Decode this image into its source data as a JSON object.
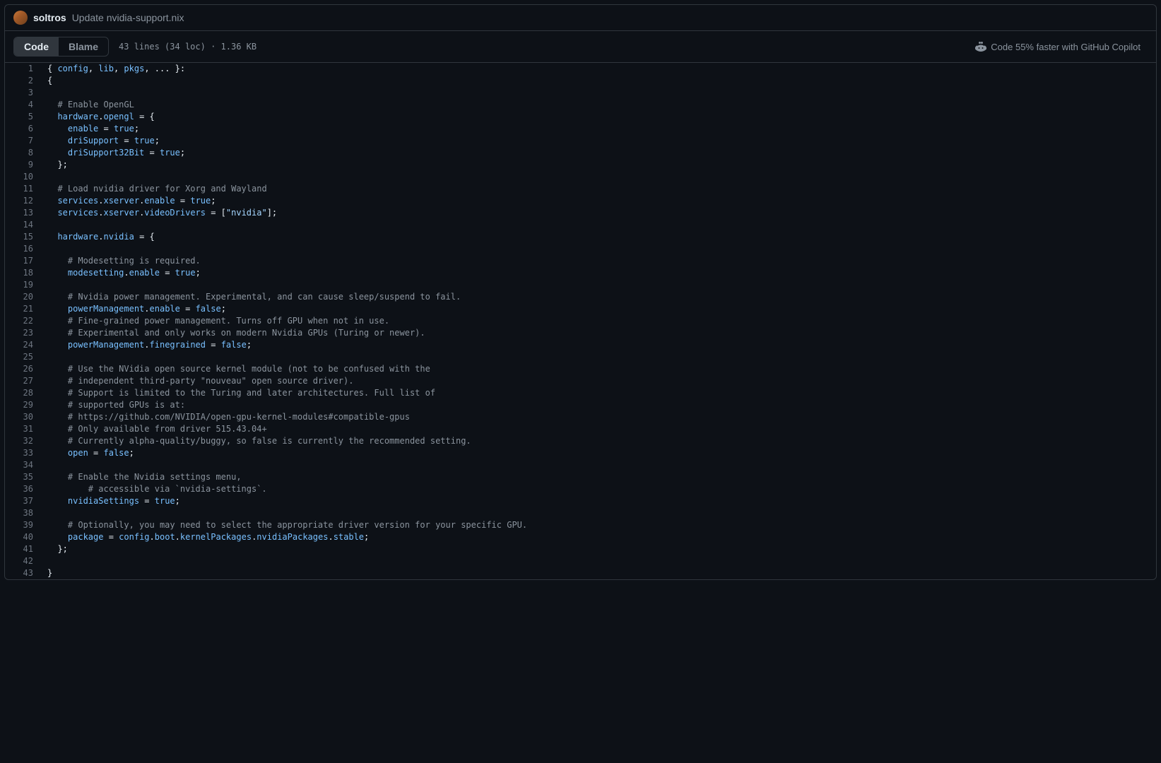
{
  "commit": {
    "author": "soltros",
    "message": "Update nvidia-support.nix"
  },
  "toolbar": {
    "code_tab": "Code",
    "blame_tab": "Blame",
    "file_info": "43 lines (34 loc) · 1.36 KB",
    "copilot_text": "Code 55% faster with GitHub Copilot"
  },
  "code_lines": [
    {
      "n": 1,
      "tokens": [
        [
          "punc",
          "{ "
        ],
        [
          "attr",
          "config"
        ],
        [
          "punc",
          ", "
        ],
        [
          "attr",
          "lib"
        ],
        [
          "punc",
          ", "
        ],
        [
          "attr",
          "pkgs"
        ],
        [
          "punc",
          ", ... }:"
        ]
      ]
    },
    {
      "n": 2,
      "tokens": [
        [
          "punc",
          "{"
        ]
      ]
    },
    {
      "n": 3,
      "tokens": []
    },
    {
      "n": 4,
      "tokens": [
        [
          "punc",
          "  "
        ],
        [
          "comment",
          "# Enable OpenGL"
        ]
      ]
    },
    {
      "n": 5,
      "tokens": [
        [
          "punc",
          "  "
        ],
        [
          "attr",
          "hardware"
        ],
        [
          "punc",
          "."
        ],
        [
          "attr",
          "opengl"
        ],
        [
          "punc",
          " = {"
        ]
      ]
    },
    {
      "n": 6,
      "tokens": [
        [
          "punc",
          "    "
        ],
        [
          "attr",
          "enable"
        ],
        [
          "punc",
          " = "
        ],
        [
          "bool",
          "true"
        ],
        [
          "punc",
          ";"
        ]
      ]
    },
    {
      "n": 7,
      "tokens": [
        [
          "punc",
          "    "
        ],
        [
          "attr",
          "driSupport"
        ],
        [
          "punc",
          " = "
        ],
        [
          "bool",
          "true"
        ],
        [
          "punc",
          ";"
        ]
      ]
    },
    {
      "n": 8,
      "tokens": [
        [
          "punc",
          "    "
        ],
        [
          "attr",
          "driSupport32Bit"
        ],
        [
          "punc",
          " = "
        ],
        [
          "bool",
          "true"
        ],
        [
          "punc",
          ";"
        ]
      ]
    },
    {
      "n": 9,
      "tokens": [
        [
          "punc",
          "  };"
        ]
      ]
    },
    {
      "n": 10,
      "tokens": []
    },
    {
      "n": 11,
      "tokens": [
        [
          "punc",
          "  "
        ],
        [
          "comment",
          "# Load nvidia driver for Xorg and Wayland"
        ]
      ]
    },
    {
      "n": 12,
      "tokens": [
        [
          "punc",
          "  "
        ],
        [
          "attr",
          "services"
        ],
        [
          "punc",
          "."
        ],
        [
          "attr",
          "xserver"
        ],
        [
          "punc",
          "."
        ],
        [
          "attr",
          "enable"
        ],
        [
          "punc",
          " = "
        ],
        [
          "bool",
          "true"
        ],
        [
          "punc",
          ";"
        ]
      ]
    },
    {
      "n": 13,
      "tokens": [
        [
          "punc",
          "  "
        ],
        [
          "attr",
          "services"
        ],
        [
          "punc",
          "."
        ],
        [
          "attr",
          "xserver"
        ],
        [
          "punc",
          "."
        ],
        [
          "attr",
          "videoDrivers"
        ],
        [
          "punc",
          " = ["
        ],
        [
          "str",
          "\"nvidia\""
        ],
        [
          "punc",
          "];"
        ]
      ]
    },
    {
      "n": 14,
      "tokens": []
    },
    {
      "n": 15,
      "tokens": [
        [
          "punc",
          "  "
        ],
        [
          "attr",
          "hardware"
        ],
        [
          "punc",
          "."
        ],
        [
          "attr",
          "nvidia"
        ],
        [
          "punc",
          " = {"
        ]
      ]
    },
    {
      "n": 16,
      "tokens": []
    },
    {
      "n": 17,
      "tokens": [
        [
          "punc",
          "    "
        ],
        [
          "comment",
          "# Modesetting is required."
        ]
      ]
    },
    {
      "n": 18,
      "tokens": [
        [
          "punc",
          "    "
        ],
        [
          "attr",
          "modesetting"
        ],
        [
          "punc",
          "."
        ],
        [
          "attr",
          "enable"
        ],
        [
          "punc",
          " = "
        ],
        [
          "bool",
          "true"
        ],
        [
          "punc",
          ";"
        ]
      ]
    },
    {
      "n": 19,
      "tokens": []
    },
    {
      "n": 20,
      "tokens": [
        [
          "punc",
          "    "
        ],
        [
          "comment",
          "# Nvidia power management. Experimental, and can cause sleep/suspend to fail."
        ]
      ]
    },
    {
      "n": 21,
      "tokens": [
        [
          "punc",
          "    "
        ],
        [
          "attr",
          "powerManagement"
        ],
        [
          "punc",
          "."
        ],
        [
          "attr",
          "enable"
        ],
        [
          "punc",
          " = "
        ],
        [
          "bool",
          "false"
        ],
        [
          "punc",
          ";"
        ]
      ]
    },
    {
      "n": 22,
      "tokens": [
        [
          "punc",
          "    "
        ],
        [
          "comment",
          "# Fine-grained power management. Turns off GPU when not in use."
        ]
      ]
    },
    {
      "n": 23,
      "tokens": [
        [
          "punc",
          "    "
        ],
        [
          "comment",
          "# Experimental and only works on modern Nvidia GPUs (Turing or newer)."
        ]
      ]
    },
    {
      "n": 24,
      "tokens": [
        [
          "punc",
          "    "
        ],
        [
          "attr",
          "powerManagement"
        ],
        [
          "punc",
          "."
        ],
        [
          "attr",
          "finegrained"
        ],
        [
          "punc",
          " = "
        ],
        [
          "bool",
          "false"
        ],
        [
          "punc",
          ";"
        ]
      ]
    },
    {
      "n": 25,
      "tokens": []
    },
    {
      "n": 26,
      "tokens": [
        [
          "punc",
          "    "
        ],
        [
          "comment",
          "# Use the NVidia open source kernel module (not to be confused with the"
        ]
      ]
    },
    {
      "n": 27,
      "tokens": [
        [
          "punc",
          "    "
        ],
        [
          "comment",
          "# independent third-party \"nouveau\" open source driver)."
        ]
      ]
    },
    {
      "n": 28,
      "tokens": [
        [
          "punc",
          "    "
        ],
        [
          "comment",
          "# Support is limited to the Turing and later architectures. Full list of"
        ]
      ]
    },
    {
      "n": 29,
      "tokens": [
        [
          "punc",
          "    "
        ],
        [
          "comment",
          "# supported GPUs is at:"
        ]
      ]
    },
    {
      "n": 30,
      "tokens": [
        [
          "punc",
          "    "
        ],
        [
          "comment",
          "# https://github.com/NVIDIA/open-gpu-kernel-modules#compatible-gpus"
        ]
      ]
    },
    {
      "n": 31,
      "tokens": [
        [
          "punc",
          "    "
        ],
        [
          "comment",
          "# Only available from driver 515.43.04+"
        ]
      ]
    },
    {
      "n": 32,
      "tokens": [
        [
          "punc",
          "    "
        ],
        [
          "comment",
          "# Currently alpha-quality/buggy, so false is currently the recommended setting."
        ]
      ]
    },
    {
      "n": 33,
      "tokens": [
        [
          "punc",
          "    "
        ],
        [
          "attr",
          "open"
        ],
        [
          "punc",
          " = "
        ],
        [
          "bool",
          "false"
        ],
        [
          "punc",
          ";"
        ]
      ]
    },
    {
      "n": 34,
      "tokens": []
    },
    {
      "n": 35,
      "tokens": [
        [
          "punc",
          "    "
        ],
        [
          "comment",
          "# Enable the Nvidia settings menu,"
        ]
      ]
    },
    {
      "n": 36,
      "tokens": [
        [
          "punc",
          "        "
        ],
        [
          "comment",
          "# accessible via `nvidia-settings`."
        ]
      ]
    },
    {
      "n": 37,
      "tokens": [
        [
          "punc",
          "    "
        ],
        [
          "attr",
          "nvidiaSettings"
        ],
        [
          "punc",
          " = "
        ],
        [
          "bool",
          "true"
        ],
        [
          "punc",
          ";"
        ]
      ]
    },
    {
      "n": 38,
      "tokens": []
    },
    {
      "n": 39,
      "tokens": [
        [
          "punc",
          "    "
        ],
        [
          "comment",
          "# Optionally, you may need to select the appropriate driver version for your specific GPU."
        ]
      ]
    },
    {
      "n": 40,
      "tokens": [
        [
          "punc",
          "    "
        ],
        [
          "attr",
          "package"
        ],
        [
          "punc",
          " = "
        ],
        [
          "attr",
          "config"
        ],
        [
          "punc",
          "."
        ],
        [
          "attr",
          "boot"
        ],
        [
          "punc",
          "."
        ],
        [
          "attr",
          "kernelPackages"
        ],
        [
          "punc",
          "."
        ],
        [
          "attr",
          "nvidiaPackages"
        ],
        [
          "punc",
          "."
        ],
        [
          "attr",
          "stable"
        ],
        [
          "punc",
          ";"
        ]
      ]
    },
    {
      "n": 41,
      "tokens": [
        [
          "punc",
          "  };"
        ]
      ]
    },
    {
      "n": 42,
      "tokens": []
    },
    {
      "n": 43,
      "tokens": [
        [
          "punc",
          "}"
        ]
      ]
    }
  ]
}
